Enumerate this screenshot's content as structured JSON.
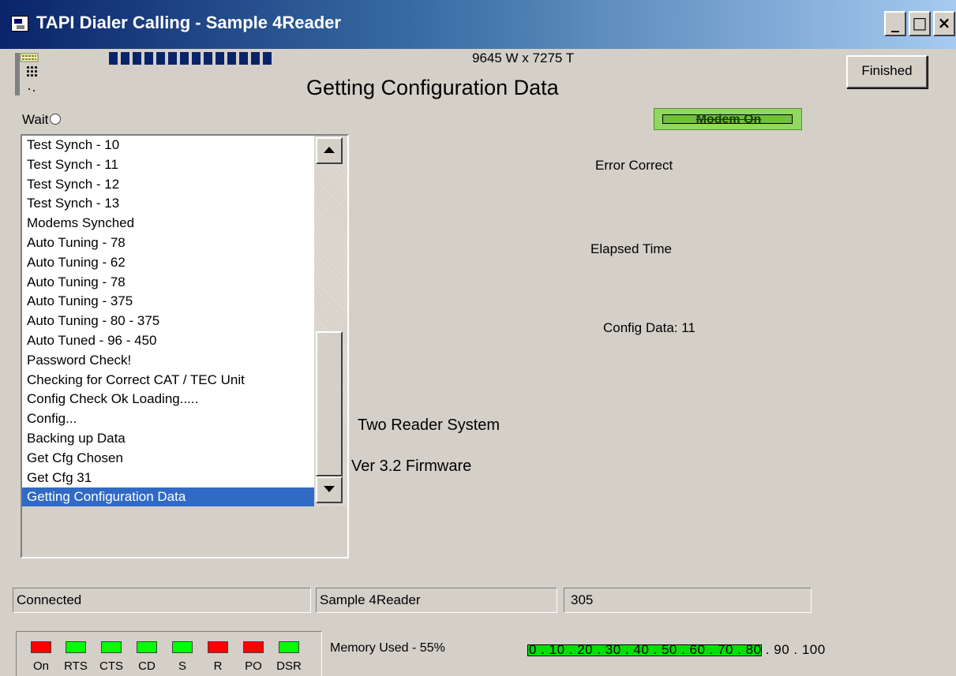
{
  "window": {
    "title": "TAPI Dialer  Calling - Sample 4Reader",
    "minimize": "_",
    "maximize": "□",
    "close": "×"
  },
  "header": {
    "progress_blocks": 14,
    "size_text": "9645 W x 7275 T",
    "heading": "Getting Configuration Data",
    "finished_label": "Finished",
    "wait_label": "Wait",
    "modem_status": "Modem On"
  },
  "log": {
    "items": [
      "Test Synch - 10",
      "Test Synch - 11",
      "Test Synch - 12",
      "Test Synch - 13",
      "Modems Synched",
      "Auto Tuning - 78",
      "Auto Tuning - 62",
      "Auto Tuning - 78",
      "Auto Tuning - 375",
      "Auto Tuning - 80 - 375",
      "Auto Tuned - 96 - 450",
      "Password Check!",
      "Checking for Correct CAT / TEC Unit",
      "Config Check Ok Loading.....",
      "Config...",
      "Backing up Data",
      "Get Cfg Chosen",
      "Get Cfg 31",
      "Getting Configuration Data"
    ],
    "selected_index": 18
  },
  "info": {
    "error_correct": "Error Correct",
    "elapsed_time": "Elapsed Time",
    "config_data": "Config Data: 11",
    "reader_system": "Two Reader System",
    "firmware": "Ver 3.2 Firmware"
  },
  "status": {
    "connection": "Connected",
    "site": "Sample 4Reader",
    "count": "305"
  },
  "leds": [
    {
      "label": "On",
      "color": "#ff0000"
    },
    {
      "label": "RTS",
      "color": "#00ff00"
    },
    {
      "label": "CTS",
      "color": "#00ff00"
    },
    {
      "label": "CD",
      "color": "#00ff00"
    },
    {
      "label": "S",
      "color": "#00ff00"
    },
    {
      "label": "R",
      "color": "#ff0000"
    },
    {
      "label": "PO",
      "color": "#ff0000"
    },
    {
      "label": "DSR",
      "color": "#00ff00"
    }
  ],
  "memory": {
    "label": "Memory Used - 55%",
    "percent": 55,
    "scale": "0 . 10 . 20 . 30 . 40 . 50 . 60 . 70 . 80 . 90 . 100"
  },
  "colors": {
    "title_bar_start": "#0a246a",
    "title_bar_end": "#a6caf0",
    "selection": "#316ac5",
    "window_bg": "#d4d0c8",
    "modem_indicator": "#90d860",
    "memory_fill": "#00e000"
  }
}
